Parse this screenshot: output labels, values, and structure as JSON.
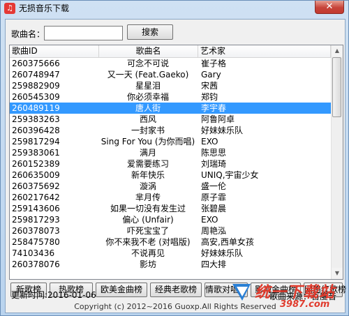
{
  "window": {
    "title": "无损音乐下载",
    "close_glyph": "✕",
    "app_icon_glyph": "♫"
  },
  "search": {
    "label": "歌曲名：",
    "value": "",
    "placeholder": "",
    "button": "搜索"
  },
  "list": {
    "columns": [
      "歌曲ID",
      "歌曲名",
      "艺术家"
    ],
    "rows": [
      {
        "id": "260375666",
        "name": "可念不可说",
        "artist": "崔子格"
      },
      {
        "id": "260748947",
        "name": "又一天 (Feat.Gaeko)",
        "artist": "Gary"
      },
      {
        "id": "259882909",
        "name": "星星泪",
        "artist": "宋茜"
      },
      {
        "id": "260545309",
        "name": "你必须幸福",
        "artist": "郑钧"
      },
      {
        "id": "260489119",
        "name": "唐人街",
        "artist": "李宇春",
        "selected": true
      },
      {
        "id": "259383263",
        "name": "西风",
        "artist": "阿鲁阿卓"
      },
      {
        "id": "260396428",
        "name": "一封家书",
        "artist": "好妹妹乐队"
      },
      {
        "id": "259817294",
        "name": "Sing For You (为你而唱)",
        "artist": "EXO"
      },
      {
        "id": "259383061",
        "name": "满月",
        "artist": "陈思思"
      },
      {
        "id": "260152389",
        "name": "爱需要练习",
        "artist": "刘瑞琦"
      },
      {
        "id": "260635009",
        "name": "新年快乐",
        "artist": "UNIQ,宇宙少女"
      },
      {
        "id": "260375692",
        "name": "漩涡",
        "artist": "盛一伦"
      },
      {
        "id": "260217642",
        "name": "芈月传",
        "artist": "原子霏"
      },
      {
        "id": "259143606",
        "name": "如果一切没有发生过",
        "artist": "张碧晨"
      },
      {
        "id": "259817293",
        "name": "偏心 (Unfair)",
        "artist": "EXO"
      },
      {
        "id": "260378073",
        "name": "吓死宝宝了",
        "artist": "周艳泓"
      },
      {
        "id": "258475780",
        "name": "你不来我不老 (对唱版)",
        "artist": "高安,西单女孩"
      },
      {
        "id": "74103436",
        "name": "不说再见",
        "artist": "好妹妹乐队"
      },
      {
        "id": "260378076",
        "name": "影坊",
        "artist": "四大排"
      }
    ]
  },
  "scrollbar": {
    "up": "▲",
    "down": "▼"
  },
  "chart_buttons": [
    "新歌榜",
    "热歌榜",
    "欧美金曲榜",
    "经典老歌榜",
    "情歌对唱榜",
    "影视金曲榜",
    "网络红歌榜"
  ],
  "footer": {
    "updated": "更新时间:2016-01-06",
    "source": "歌曲来源：百度音",
    "copyright": "Copyright (c)  2012~2016 Guoxp.All Rights Reserved"
  },
  "watermark": {
    "text": "统一下载站",
    "url": "3987.com"
  }
}
